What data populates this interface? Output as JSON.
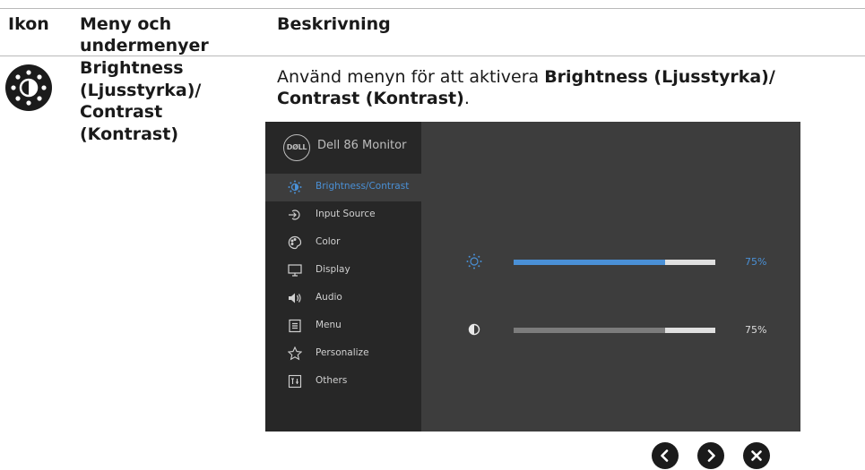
{
  "table": {
    "headers": {
      "icon": "Ikon",
      "menu": "Meny och undermenyer",
      "description": "Beskrivning"
    },
    "row": {
      "icon": "brightness-contrast-icon",
      "menu_name_lines": [
        "Brightness",
        "(Ljusstyrka)/",
        "Contrast",
        "(Kontrast)"
      ],
      "description": {
        "prefix": "Använd menyn för att aktivera ",
        "bold": "Brightness (Ljusstyrka)/",
        "bold2": "Contrast (Kontrast)",
        "suffix": "."
      }
    }
  },
  "osd": {
    "logo": "DØLL",
    "model": "Dell 86 Monitor",
    "active_item": "Brightness/Contrast",
    "items": [
      {
        "label": "Brightness/Contrast",
        "icon": "brightness-icon"
      },
      {
        "label": "Input Source",
        "icon": "input-source-icon"
      },
      {
        "label": "Color",
        "icon": "color-palette-icon"
      },
      {
        "label": "Display",
        "icon": "display-icon"
      },
      {
        "label": "Audio",
        "icon": "speaker-icon"
      },
      {
        "label": "Menu",
        "icon": "menu-icon"
      },
      {
        "label": "Personalize",
        "icon": "star-icon"
      },
      {
        "label": "Others",
        "icon": "others-icon"
      }
    ],
    "controls": {
      "brightness": {
        "value": 75,
        "display": "75%",
        "icon": "brightness-icon"
      },
      "contrast": {
        "value": 75,
        "display": "75%",
        "icon": "contrast-icon"
      }
    },
    "colors": {
      "accent": "#4a90d6",
      "panel": "#3d3d3d",
      "sidebar": "#272727"
    }
  },
  "nav_buttons": [
    {
      "icon": "chevron-left-icon"
    },
    {
      "icon": "chevron-right-icon"
    },
    {
      "icon": "close-icon"
    }
  ]
}
